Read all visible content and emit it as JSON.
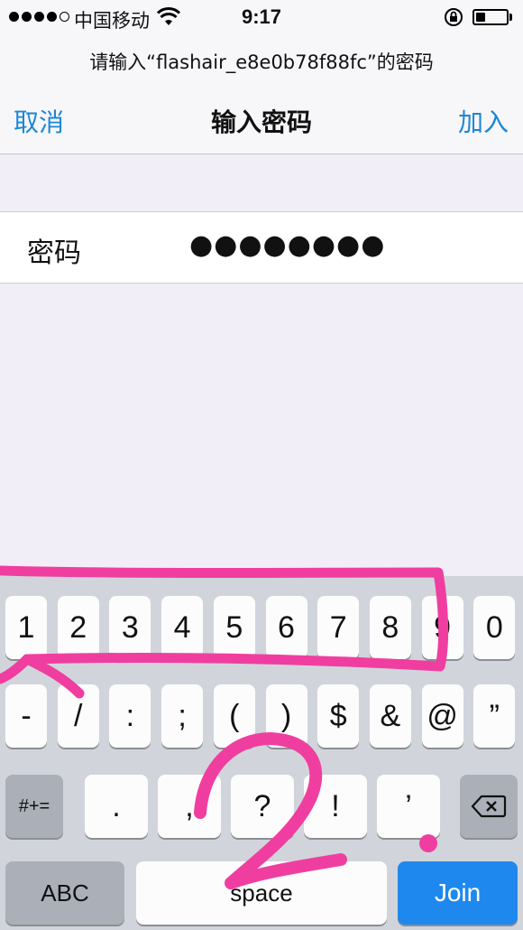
{
  "status_bar": {
    "carrier": "中国移动",
    "time": "9:17",
    "battery_level": 0.3
  },
  "prompt": "请输入“flashair_e8e0b78f88fc”的密码",
  "nav": {
    "cancel": "取消",
    "title": "输入密码",
    "join": "加入"
  },
  "password_field": {
    "label": "密码",
    "masked_value": "●●●●●●●●"
  },
  "keyboard": {
    "row1": [
      "1",
      "2",
      "3",
      "4",
      "5",
      "6",
      "7",
      "8",
      "9",
      "0"
    ],
    "row2": [
      "-",
      "/",
      ":",
      ";",
      "(",
      ")",
      "$",
      "&",
      "@",
      "”"
    ],
    "row3": [
      ".",
      ",",
      "?",
      "!",
      "’"
    ],
    "symbols_key": "#+=",
    "abc_key": "ABC",
    "space_key": "space",
    "join_key": "Join"
  },
  "annotation": {
    "number": "2",
    "color": "#f03ea0"
  },
  "colors": {
    "accent": "#1a87d6",
    "join_key": "#1f88ee",
    "keyboard_bg": "#d1d5db",
    "page_bg": "#f2eef8"
  }
}
